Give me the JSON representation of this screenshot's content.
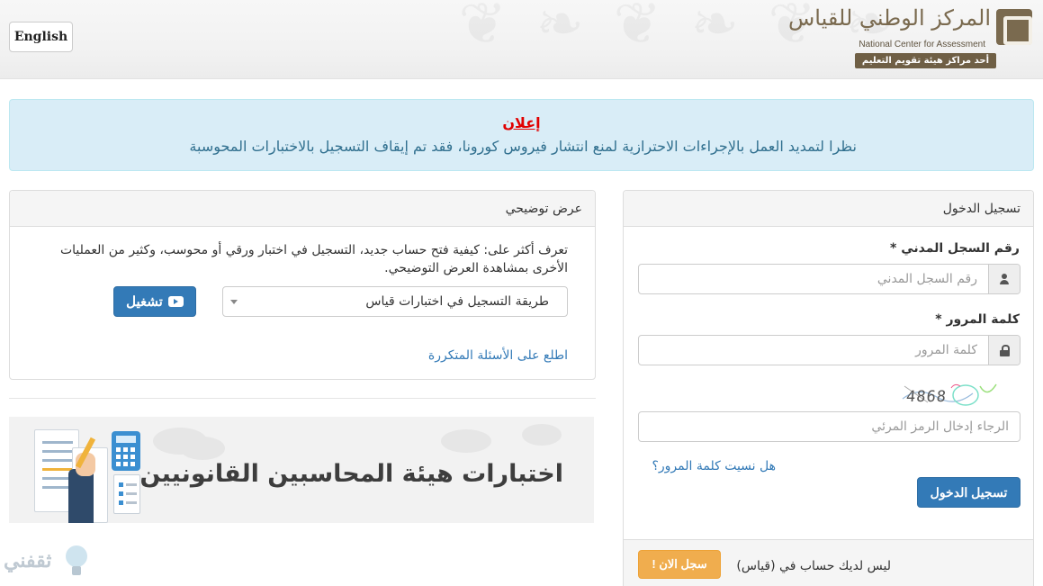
{
  "header": {
    "language_button": "English",
    "logo": {
      "arabic_name": "المركز الوطني للقياس",
      "english_name": "National Center for Assessment",
      "tagline": "أحد مراكز هيئة تقويم التعليم",
      "mark_letters": "قياس"
    }
  },
  "announcement": {
    "title": "إعلان",
    "text": "نظرا لتمديد العمل بالإجراءات الاحترازية لمنع انتشار فيروس كورونا، فقد تم إيقاف التسجيل بالاختبارات المحوسبة"
  },
  "demo_panel": {
    "heading": "عرض توضيحي",
    "description": "تعرف أكثر على: كيفية فتح حساب جديد، التسجيل في اختبار ورقي أو محوسب، وكثير من العمليات الأخرى بمشاهدة العرض التوضيحي.",
    "selected_option": "طريقة التسجيل في اختبارات قياس",
    "play_button": "تشغيل",
    "faq_link": "اطلع على الأسئلة المتكررة"
  },
  "banner": {
    "text": "اختبارات هيئة المحاسبين القانونيين"
  },
  "login_panel": {
    "heading": "تسجيل الدخول",
    "id_label": "رقم السجل المدني *",
    "id_placeholder": "رقم السجل المدني",
    "password_label": "كلمة المرور *",
    "password_placeholder": "كلمة المرور",
    "captcha_text": "4868",
    "captcha_placeholder": "الرجاء إدخال الرمز المرئي",
    "forgot_link": "هل نسيت كلمة المرور؟",
    "login_button": "تسجيل الدخول",
    "footer_text": "ليس لديك حساب في (قياس)",
    "register_button": "سجل الان !"
  },
  "watermark": {
    "text": "ثقفني"
  },
  "colors": {
    "primary": "#337ab7",
    "warning": "#f0ad4e",
    "alert_bg": "#d9edf7",
    "alert_title": "#e10000",
    "alert_text": "#31708f"
  }
}
